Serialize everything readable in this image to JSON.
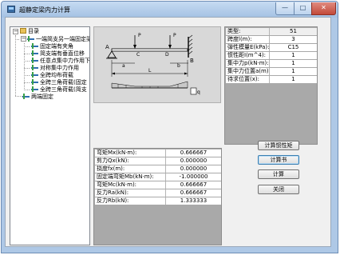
{
  "window": {
    "title": "超静定梁内力计算",
    "minimize_glyph": "—",
    "maximize_glyph": "□",
    "close_glyph": "✕"
  },
  "tree": {
    "root": "目录",
    "group1": "一端简支另一端固定梁",
    "items": [
      "固定端有夹角",
      "简支端有垂直位移",
      "任意点集中力作用下",
      "对称集中力作用",
      "全跨均布荷载",
      "全跨三角荷载(固定",
      "全跨三角荷载(简支"
    ],
    "group2": "两端固定"
  },
  "diagram": {
    "label_a": "A",
    "label_b": "B",
    "label_c": "C",
    "label_d": "D",
    "label_p": "P",
    "label_a_dim": "a",
    "label_b_dim": "b",
    "label_l": "L",
    "label_q": "q"
  },
  "params": [
    {
      "label": "类型:",
      "value": "51",
      "header": true
    },
    {
      "label": "跨度l(m):",
      "value": "3"
    },
    {
      "label": "弹性模量E(kPa):",
      "value": "C15"
    },
    {
      "label": "惯性距I(m^4):",
      "value": "1"
    },
    {
      "label": "集中力p(kN·m):",
      "value": "1"
    },
    {
      "label": "集中力位置a(m):",
      "value": "1"
    },
    {
      "label": "待求位置(x):",
      "value": "1"
    }
  ],
  "results": [
    {
      "label": "弯矩Mx(kN·m):",
      "value": "0.666667"
    },
    {
      "label": "剪力Qx(kN):",
      "value": "0.000000"
    },
    {
      "label": "挠度fx(m):",
      "value": "0.000000"
    },
    {
      "label": "固定端弯矩Mb(kN·m):",
      "value": "-1.000000"
    },
    {
      "label": "弯矩Mc(kN·m):",
      "value": "0.666667"
    },
    {
      "label": "反力Ra(kN):",
      "value": "0.666667"
    },
    {
      "label": "反力Rb(kN):",
      "value": "1.333333"
    }
  ],
  "buttons": {
    "calc_inertia": "计算惯性矩",
    "report": "计算书",
    "calculate": "计算",
    "close": "关闭"
  }
}
